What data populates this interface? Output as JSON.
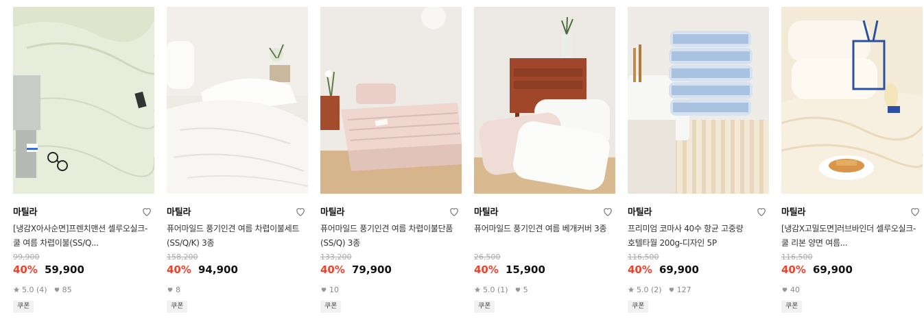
{
  "products": [
    {
      "brand": "마틸라",
      "title": "[냉감X아사순면]프렌치맨션 셀루오실크-쿨 여름 차렵이불(SS/Q...",
      "original_price": "99,900",
      "discount": "40%",
      "price": "59,900",
      "rating": "5.0",
      "review_count": "(4)",
      "likes": "85",
      "badge": "쿠폰"
    },
    {
      "brand": "마틸라",
      "title": "퓨어마일드 풍기인견 여름 차렵이불세트(SS/Q/K) 3종",
      "original_price": "158,200",
      "discount": "40%",
      "price": "94,900",
      "likes": "8",
      "badge": "쿠폰"
    },
    {
      "brand": "마틸라",
      "title": "퓨어마일드 풍기인견 여름 차렵이불단품(SS/Q) 3종",
      "original_price": "133,200",
      "discount": "40%",
      "price": "79,900",
      "likes": "10",
      "badge": "쿠폰"
    },
    {
      "brand": "마틸라",
      "title": "퓨어마일드 풍기인견 여름 베개커버 3종",
      "original_price": "26,500",
      "discount": "40%",
      "price": "15,900",
      "rating": "5.0",
      "review_count": "(1)",
      "likes": "5",
      "badge": "쿠폰"
    },
    {
      "brand": "마틸라",
      "title": "프리미엄 코마사 40수 항균 고중량 호텔타월 200g-디자인 5P",
      "original_price": "116,500",
      "discount": "40%",
      "price": "69,900",
      "rating": "5.0",
      "review_count": "(2)",
      "likes": "127",
      "badge": "쿠폰"
    },
    {
      "brand": "마틸라",
      "title": "[냉감X고밀도면]러브바인더 셀루오실크-쿨 리본 양면 여름...",
      "original_price": "116,500",
      "discount": "40%",
      "price": "69,900",
      "likes": "40",
      "badge": "쿠폰"
    }
  ],
  "colors": {
    "discount": "#f0412d",
    "price": "#111111",
    "muted": "#888888",
    "badge_bg": "#f2f2f2"
  },
  "icons": {
    "wishlist": "heart-outline-icon",
    "rating": "star-icon",
    "likes": "heart-filled-icon"
  }
}
